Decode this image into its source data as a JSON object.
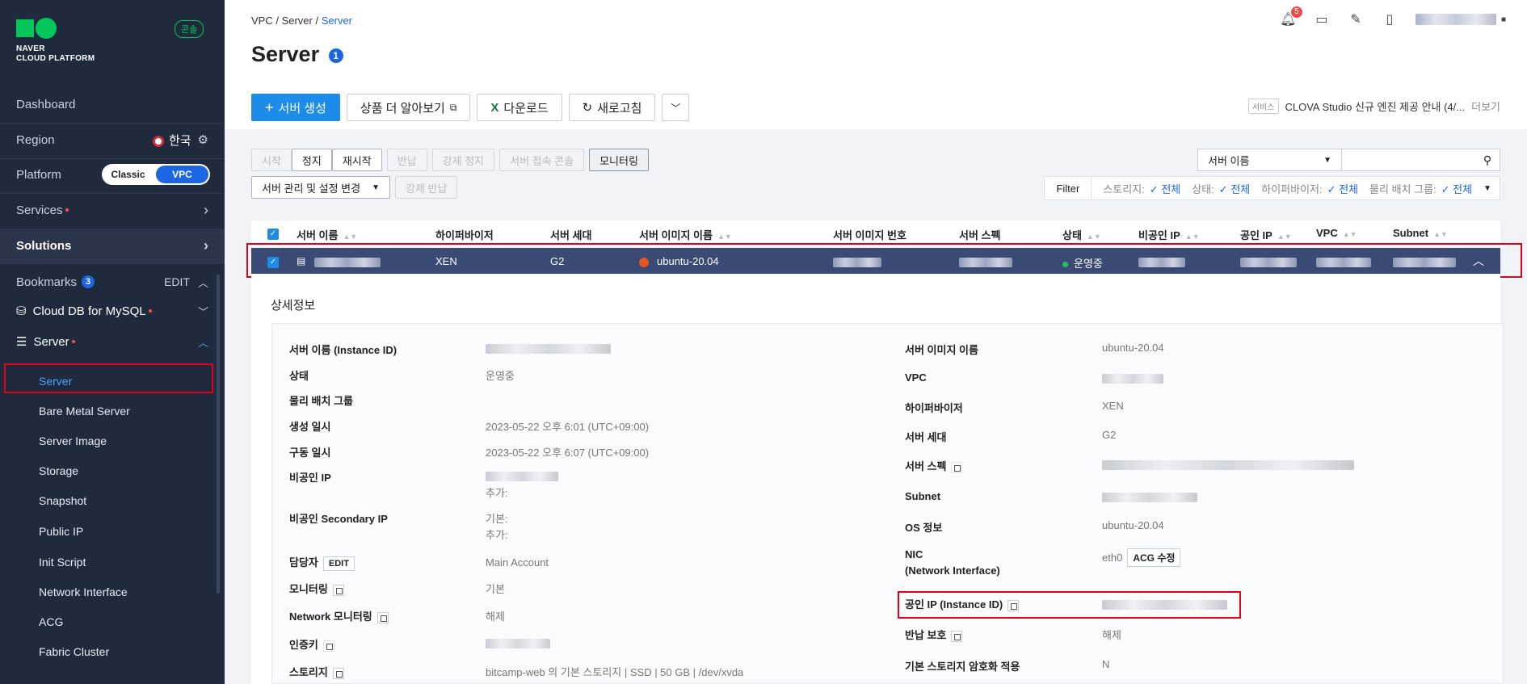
{
  "sidebar": {
    "brand_line1": "NAVER",
    "brand_line2": "CLOUD PLATFORM",
    "console": "콘솔",
    "dashboard": "Dashboard",
    "region_label": "Region",
    "region_value": "한국",
    "platform_label": "Platform",
    "platform_classic": "Classic",
    "platform_vpc": "VPC",
    "services": "Services",
    "solutions": "Solutions",
    "bookmarks": "Bookmarks",
    "bookmarks_count": "3",
    "bookmarks_edit": "EDIT",
    "cloud_db": "Cloud DB for MySQL",
    "server_group": "Server",
    "sub_items": [
      "Server",
      "Bare Metal Server",
      "Server Image",
      "Storage",
      "Snapshot",
      "Public IP",
      "Init Script",
      "Network Interface",
      "ACG",
      "Fabric Cluster"
    ]
  },
  "header": {
    "breadcrumb": [
      "VPC",
      "Server",
      "Server"
    ],
    "title": "Server",
    "title_badge": "1",
    "notif_count": "5"
  },
  "toolbar": {
    "create": "서버 생성",
    "learn_more": "상품 더 알아보기",
    "download": "다운로드",
    "refresh": "새로고침"
  },
  "notice": {
    "tag": "서비스",
    "text": "CLOVA Studio 신규 엔진 제공 안내 (4/...",
    "more": "더보기"
  },
  "actions": {
    "row1": [
      "시작",
      "정지",
      "재시작",
      "반납",
      "강제 정지",
      "서버 접속 콘솔",
      "모니터링"
    ],
    "manage": "서버 관리 및 설정 변경",
    "force_return": "강제 반납"
  },
  "search": {
    "select": "서버 이름"
  },
  "filter": {
    "label": "Filter",
    "items": [
      {
        "name": "스토리지:",
        "value": "전체"
      },
      {
        "name": "상태:",
        "value": "전체"
      },
      {
        "name": "하이퍼바이저:",
        "value": "전체"
      },
      {
        "name": "물리 배치 그룹:",
        "value": "전체"
      }
    ]
  },
  "table": {
    "headers": [
      "서버 이름",
      "하이퍼바이저",
      "서버 세대",
      "서버 이미지 이름",
      "서버 이미지 번호",
      "서버 스펙",
      "상태",
      "비공인 IP",
      "공인 IP",
      "VPC",
      "Subnet"
    ],
    "row": {
      "hypervisor": "XEN",
      "generation": "G2",
      "image": "ubuntu-20.04",
      "status": "운영중"
    }
  },
  "detail": {
    "title": "상세정보",
    "left": [
      {
        "label": "서버 이름 (Instance ID)",
        "value": ""
      },
      {
        "label": "상태",
        "value": "운영중"
      },
      {
        "label": "물리 배치 그룹",
        "value": ""
      },
      {
        "label": "생성 일시",
        "value": "2023-05-22 오후 6:01 (UTC+09:00)"
      },
      {
        "label": "구동 일시",
        "value": "2023-05-22 오후 6:07 (UTC+09:00)"
      },
      {
        "label": "비공인 IP",
        "value": "추가:"
      },
      {
        "label": "비공인 Secondary IP",
        "value": "기본:",
        "value2": "추가:"
      },
      {
        "label": "담당자",
        "value": "Main Account",
        "btn": "EDIT"
      },
      {
        "label": "모니터링",
        "value": "기본"
      },
      {
        "label": "Network 모니터링",
        "value": "해제"
      },
      {
        "label": "인증키",
        "value": ""
      },
      {
        "label": "스토리지",
        "value": "bitcamp-web 의 기본 스토리지 | SSD | 50 GB | /dev/xvda"
      }
    ],
    "right": [
      {
        "label": "서버 이미지 이름",
        "value": "ubuntu-20.04"
      },
      {
        "label": "VPC",
        "value": ""
      },
      {
        "label": "하이퍼바이저",
        "value": "XEN"
      },
      {
        "label": "서버 세대",
        "value": "G2"
      },
      {
        "label": "서버 스펙",
        "value": ""
      },
      {
        "label": "Subnet",
        "value": ""
      },
      {
        "label": "OS 정보",
        "value": "ubuntu-20.04"
      },
      {
        "label": "NIC",
        "label2": "(Network Interface)",
        "value": "eth0",
        "btn": "ACG 수정"
      },
      {
        "label": "공인 IP (Instance ID)",
        "value": ""
      },
      {
        "label": "반납 보호",
        "value": "해제"
      },
      {
        "label": "기본 스토리지 암호화 적용",
        "value": "N"
      }
    ]
  },
  "colors": {
    "sidebar_bg": "#1f2a3d",
    "accent": "#1c66e4",
    "brand": "#03c75a",
    "highlight": "#e4001b"
  }
}
